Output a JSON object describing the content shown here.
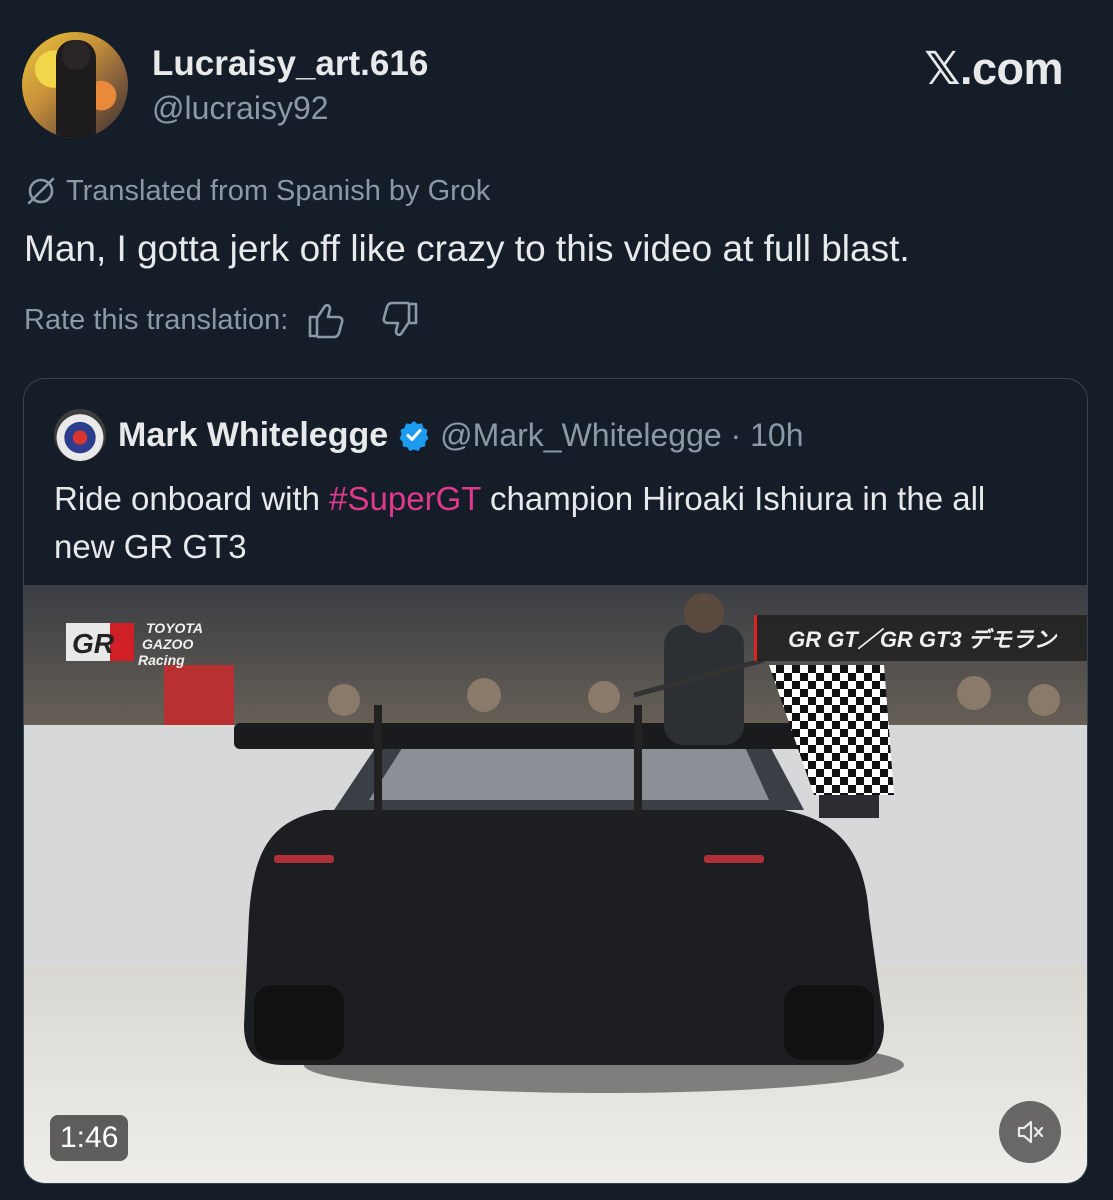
{
  "author": {
    "name": "Lucraisy_art.616",
    "handle": "@lucraisy92"
  },
  "branding": {
    "site": "X.com"
  },
  "translation": {
    "notice": "Translated from Spanish by Grok",
    "rate_label": "Rate this translation:"
  },
  "tweet": {
    "text": "Man, I gotta jerk off like crazy to this video at full blast."
  },
  "quoted": {
    "name": "Mark Whitelegge",
    "handle": "@Mark_Whitelegge",
    "time": "10h",
    "text_before": "Ride onboard with ",
    "hashtag": "#SuperGT",
    "text_after": " champion Hiroaki Ishiura in the all new GR GT3",
    "video": {
      "duration": "1:46",
      "overlay_logo": {
        "gr": "GR",
        "line1": "TOYOTA",
        "line2": "GAZOO",
        "line3": "Racing"
      },
      "overlay_banner": "GR GT／GR GT3 デモラン"
    }
  },
  "colors": {
    "background": "#151d28",
    "secondary_text": "#8b98a5",
    "hashtag": "#e0398e",
    "verified": "#1d9bf0"
  }
}
